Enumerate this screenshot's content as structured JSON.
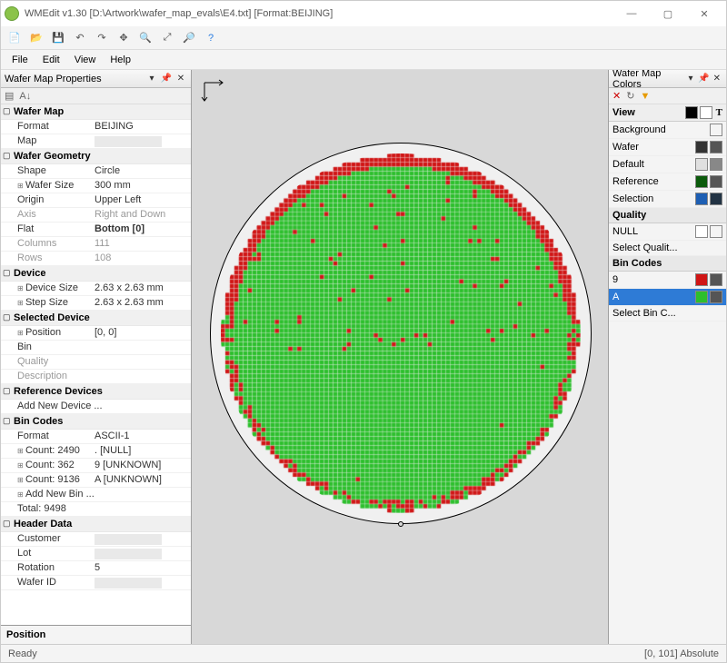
{
  "title": "WMEdit v1.30 [D:\\Artwork\\wafer_map_evals\\E4.txt] [Format:BEIJING]",
  "menus": [
    "File",
    "Edit",
    "View",
    "Help"
  ],
  "panels": {
    "props": "Wafer Map Properties",
    "colors": "Wafer Map Colors"
  },
  "props": {
    "cat_wafermap": "Wafer Map",
    "format_k": "Format",
    "format_v": "BEIJING",
    "map_k": "Map",
    "cat_geom": "Wafer Geometry",
    "shape_k": "Shape",
    "shape_v": "Circle",
    "wsize_k": "Wafer Size",
    "wsize_v": "300 mm",
    "origin_k": "Origin",
    "origin_v": "Upper Left",
    "axis_k": "Axis",
    "axis_v": "Right and Down",
    "flat_k": "Flat",
    "flat_v": "Bottom [0]",
    "cols_k": "Columns",
    "cols_v": "111",
    "rows_k": "Rows",
    "rows_v": "108",
    "cat_device": "Device",
    "dsize_k": "Device Size",
    "dsize_v": "2.63 x 2.63 mm",
    "ssize_k": "Step Size",
    "ssize_v": "2.63 x 2.63 mm",
    "cat_sel": "Selected Device",
    "pos_k": "Position",
    "pos_v": "[0, 0]",
    "bin_k": "Bin",
    "qual_k": "Quality",
    "desc_k": "Description",
    "cat_ref": "Reference Devices",
    "addref_k": "Add New Device ...",
    "cat_bincodes": "Bin Codes",
    "bformat_k": "Format",
    "bformat_v": "ASCII-1",
    "c1_k": "Count: 2490",
    "c1_v": ". [NULL]",
    "c2_k": "Count: 362",
    "c2_v": "9 [UNKNOWN]",
    "c3_k": "Count: 9136",
    "c3_v": "A [UNKNOWN]",
    "addbin_k": "Add New Bin ...",
    "total_k": "Total: 9498",
    "cat_hdr": "Header Data",
    "cust_k": "Customer",
    "lot_k": "Lot",
    "rot_k": "Rotation",
    "rot_v": "5",
    "wid_k": "Wafer ID",
    "foot": "Position"
  },
  "colors": {
    "view": "View",
    "bg": "Background",
    "wafer": "Wafer",
    "default": "Default",
    "ref": "Reference",
    "sel": "Selection",
    "cat_q": "Quality",
    "null": "NULL",
    "selq": "Select Qualit...",
    "cat_b": "Bin Codes",
    "b9": "9",
    "bA": "A",
    "selb": "Select Bin C...",
    "sw": {
      "bg": "#e8e8e8",
      "wafer": "#333333",
      "def": "#e0e0e0",
      "ref": "#0b5a0b",
      "sel": "#1e5fb3",
      "b9": "#d01616",
      "bA": "#2dbf2d"
    }
  },
  "status": {
    "ready": "Ready",
    "pos": "[0, 101] Absolute"
  },
  "chart_data": {
    "type": "wafer_map",
    "diameter_mm": 300,
    "cols": 111,
    "rows": 108,
    "bins": [
      {
        "code": ".",
        "name": "NULL",
        "count": 2490,
        "color": "#e8e8e8"
      },
      {
        "code": "9",
        "name": "UNKNOWN",
        "count": 362,
        "color": "#d01616"
      },
      {
        "code": "A",
        "name": "UNKNOWN",
        "count": 9136,
        "color": "#2dbf2d"
      }
    ],
    "flat": "Bottom",
    "origin": "Upper Left"
  }
}
